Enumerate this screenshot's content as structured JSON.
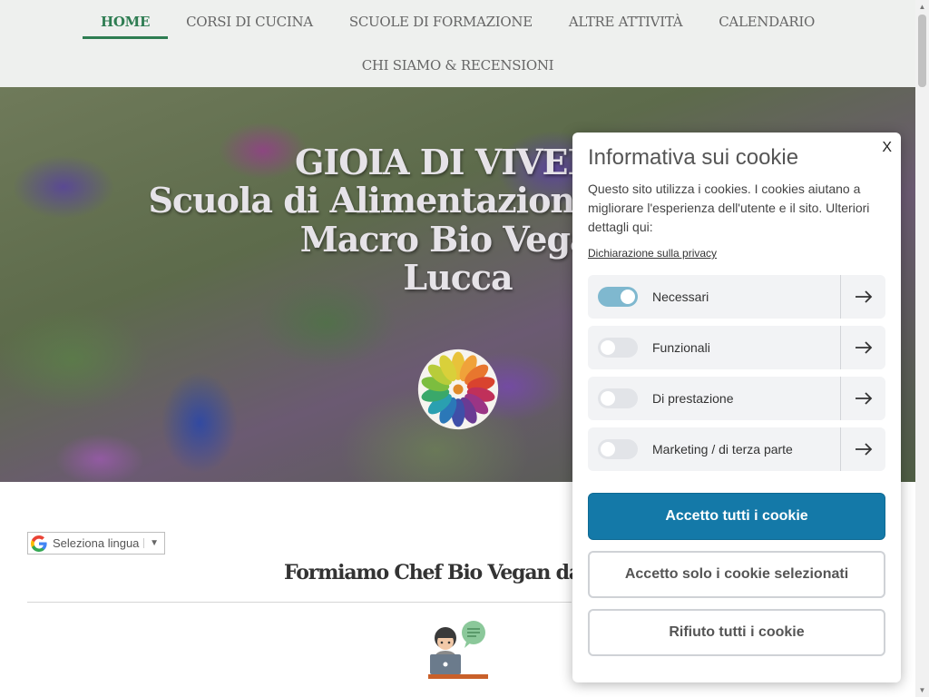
{
  "nav": {
    "items": [
      {
        "label": "HOME",
        "active": true
      },
      {
        "label": "CORSI DI CUCINA"
      },
      {
        "label": "SCUOLE DI FORMAZIONE"
      },
      {
        "label": "ALTRE ATTIVITÀ"
      },
      {
        "label": "CALENDARIO"
      },
      {
        "label": "CHI SIAMO & RECENSIONI"
      }
    ],
    "accent_color": "#2e7d52"
  },
  "hero": {
    "line1": "GIOIA DI VIVERE",
    "line2": "Scuola di Alimentazione e Cucina",
    "line3": "Macro Bio Vegan",
    "line4": "Lucca",
    "logo_icon": "color-wheel-logo"
  },
  "language": {
    "label": "Seleziona lingua",
    "arrow": "▼",
    "icon": "google-icon"
  },
  "content": {
    "title": "Formiamo Chef Bio Vegan dal",
    "illustration_icon": "teacher-chat-illustration"
  },
  "cookie": {
    "close_label": "X",
    "title": "Informativa sui cookie",
    "description": "Questo sito utilizza i cookies. I cookies aiutano a migliorare l'esperienza dell'utente e il sito. Ulteriori dettagli qui:",
    "privacy_link": "Dichiarazione sulla privacy",
    "categories": [
      {
        "label": "Necessari",
        "enabled": true
      },
      {
        "label": "Funzionali",
        "enabled": false
      },
      {
        "label": "Di prestazione",
        "enabled": false
      },
      {
        "label": "Marketing / di terza parte",
        "enabled": false
      }
    ],
    "accept_all": "Accetto tutti i cookie",
    "accept_selected": "Accetto solo i cookie selezionati",
    "reject_all": "Rifiuto tutti i cookie",
    "primary_color": "#1479a8"
  }
}
